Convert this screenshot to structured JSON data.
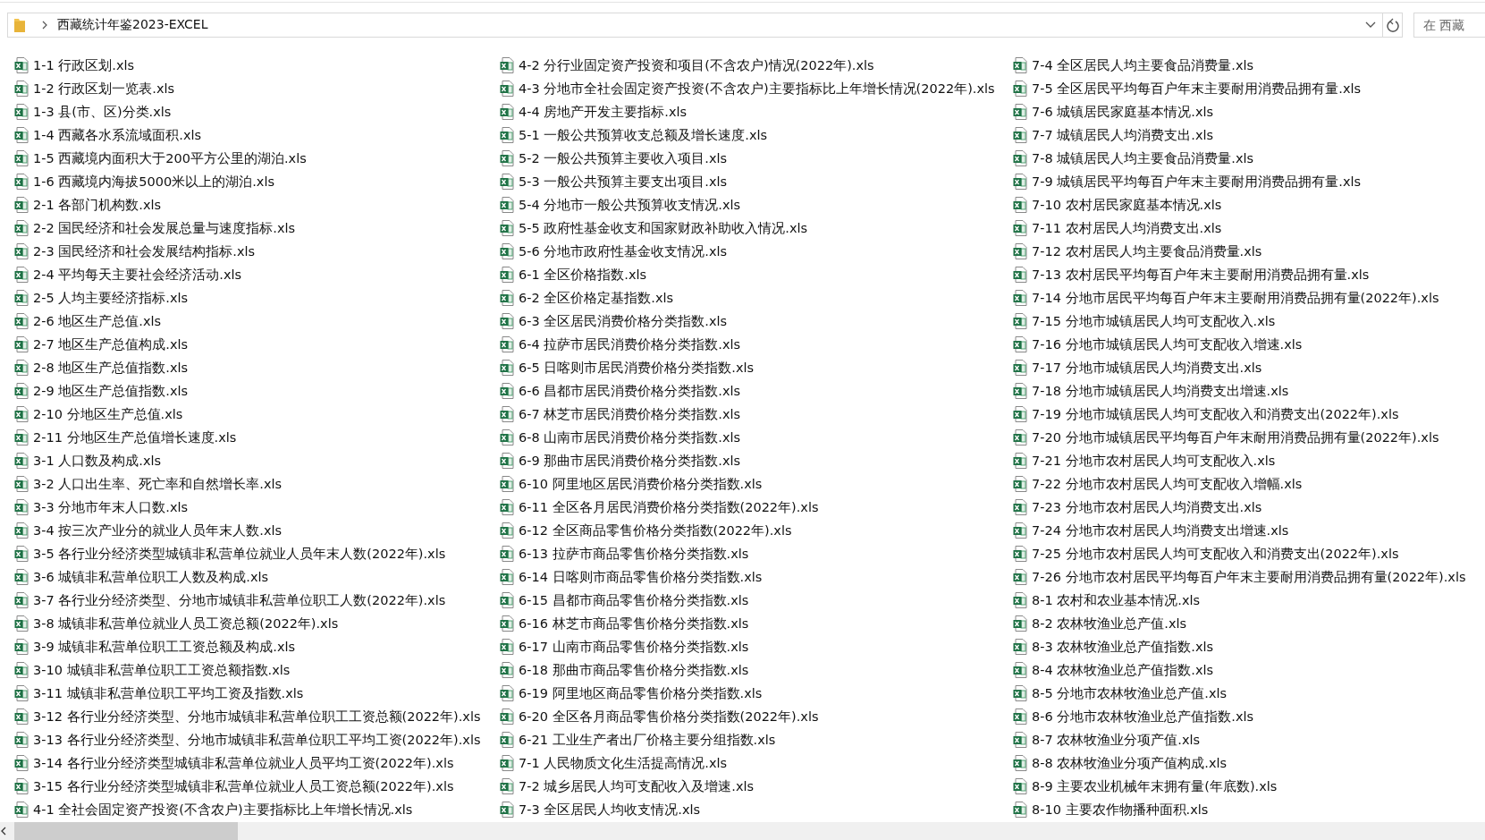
{
  "address_bar": {
    "path": "西藏统计年鉴2023-EXCEL"
  },
  "search": {
    "placeholder": "在 西藏"
  },
  "file_columns": [
    [
      "1-1 行政区划.xls",
      "1-2 行政区划一览表.xls",
      "1-3 县(市、区)分类.xls",
      "1-4 西藏各水系流域面积.xls",
      "1-5 西藏境内面积大于200平方公里的湖泊.xls",
      "1-6 西藏境内海拔5000米以上的湖泊.xls",
      "2-1 各部门机构数.xls",
      "2-2 国民经济和社会发展总量与速度指标.xls",
      "2-3 国民经济和社会发展结构指标.xls",
      "2-4 平均每天主要社会经济活动.xls",
      "2-5 人均主要经济指标.xls",
      "2-6 地区生产总值.xls",
      "2-7 地区生产总值构成.xls",
      "2-8 地区生产总值指数.xls",
      "2-9 地区生产总值指数.xls",
      "2-10 分地区生产总值.xls",
      "2-11 分地区生产总值增长速度.xls",
      "3-1 人口数及构成.xls",
      "3-2 人口出生率、死亡率和自然增长率.xls",
      "3-3 分地市年末人口数.xls",
      "3-4 按三次产业分的就业人员年末人数.xls",
      "3-5 各行业分经济类型城镇非私营单位就业人员年末人数(2022年).xls",
      "3-6 城镇非私营单位职工人数及构成.xls",
      "3-7 各行业分经济类型、分地市城镇非私营单位职工人数(2022年).xls",
      "3-8 城镇非私营单位就业人员工资总额(2022年).xls",
      "3-9 城镇非私营单位职工工资总额及构成.xls",
      "3-10 城镇非私营单位职工工资总额指数.xls",
      "3-11 城镇非私营单位职工平均工资及指数.xls",
      "3-12 各行业分经济类型、分地市城镇非私营单位职工工资总额(2022年).xls",
      "3-13 各行业分经济类型、分地市城镇非私营单位职工平均工资(2022年).xls",
      "3-14 各行业分经济类型城镇非私营单位就业人员平均工资(2022年).xls",
      "3-15 各行业分经济类型城镇非私营单位就业人员工资总额(2022年).xls",
      "4-1 全社会固定资产投资(不含农户)主要指标比上年增长情况.xls"
    ],
    [
      "4-2 分行业固定资产投资和项目(不含农户)情况(2022年).xls",
      "4-3 分地市全社会固定资产投资(不含农户)主要指标比上年增长情况(2022年).xls",
      "4-4 房地产开发主要指标.xls",
      "5-1 一般公共预算收支总额及增长速度.xls",
      "5-2 一般公共预算主要收入项目.xls",
      "5-3 一般公共预算主要支出项目.xls",
      "5-4 分地市一般公共预算收支情况.xls",
      "5-5 政府性基金收支和国家财政补助收入情况.xls",
      "5-6 分地市政府性基金收支情况.xls",
      "6-1 全区价格指数.xls",
      "6-2 全区价格定基指数.xls",
      "6-3 全区居民消费价格分类指数.xls",
      "6-4 拉萨市居民消费价格分类指数.xls",
      "6-5 日喀则市居民消费价格分类指数.xls",
      "6-6 昌都市居民消费价格分类指数.xls",
      "6-7 林芝市居民消费价格分类指数.xls",
      "6-8 山南市居民消费价格分类指数.xls",
      "6-9 那曲市居民消费价格分类指数.xls",
      "6-10 阿里地区居民消费价格分类指数.xls",
      "6-11 全区各月居民消费价格分类指数(2022年).xls",
      "6-12 全区商品零售价格分类指数(2022年).xls",
      "6-13 拉萨市商品零售价格分类指数.xls",
      "6-14 日喀则市商品零售价格分类指数.xls",
      "6-15 昌都市商品零售价格分类指数.xls",
      "6-16 林芝市商品零售价格分类指数.xls",
      "6-17 山南市商品零售价格分类指数.xls",
      "6-18 那曲市商品零售价格分类指数.xls",
      "6-19 阿里地区商品零售价格分类指数.xls",
      "6-20 全区各月商品零售价格分类指数(2022年).xls",
      "6-21 工业生产者出厂价格主要分组指数.xls",
      "7-1 人民物质文化生活提高情况.xls",
      "7-2 城乡居民人均可支配收入及增速.xls",
      "7-3 全区居民人均收支情况.xls"
    ],
    [
      "7-4 全区居民人均主要食品消费量.xls",
      "7-5 全区居民平均每百户年末主要耐用消费品拥有量.xls",
      "7-6 城镇居民家庭基本情况.xls",
      "7-7 城镇居民人均消费支出.xls",
      "7-8 城镇居民人均主要食品消费量.xls",
      "7-9 城镇居民平均每百户年末主要耐用消费品拥有量.xls",
      "7-10 农村居民家庭基本情况.xls",
      "7-11 农村居民人均消费支出.xls",
      "7-12 农村居民人均主要食品消费量.xls",
      "7-13 农村居民平均每百户年末主要耐用消费品拥有量.xls",
      "7-14 分地市居民平均每百户年末主要耐用消费品拥有量(2022年).xls",
      "7-15 分地市城镇居民人均可支配收入.xls",
      "7-16 分地市城镇居民人均可支配收入增速.xls",
      "7-17 分地市城镇居民人均消费支出.xls",
      "7-18 分地市城镇居民人均消费支出增速.xls",
      "7-19 分地市城镇居民人均可支配收入和消费支出(2022年).xls",
      "7-20 分地市城镇居民平均每百户年末耐用消费品拥有量(2022年).xls",
      "7-21 分地市农村居民人均可支配收入.xls",
      "7-22 分地市农村居民人均可支配收入增幅.xls",
      "7-23 分地市农村居民人均消费支出.xls",
      "7-24 分地市农村居民人均消费支出增速.xls",
      "7-25 分地市农村居民人均可支配收入和消费支出(2022年).xls",
      "7-26 分地市农村居民平均每百户年末主要耐用消费品拥有量(2022年).xls",
      "8-1 农村和农业基本情况.xls",
      "8-2 农林牧渔业总产值.xls",
      "8-3 农林牧渔业总产值指数.xls",
      "8-4 农林牧渔业总产值指数.xls",
      "8-5 分地市农林牧渔业总产值.xls",
      "8-6 分地市农林牧渔业总产值指数.xls",
      "8-7 农林牧渔业分项产值.xls",
      "8-8 农林牧渔业分项产值构成.xls",
      "8-9 主要农业机械年末拥有量(年底数).xls",
      "8-10 主要农作物播种面积.xls"
    ]
  ]
}
